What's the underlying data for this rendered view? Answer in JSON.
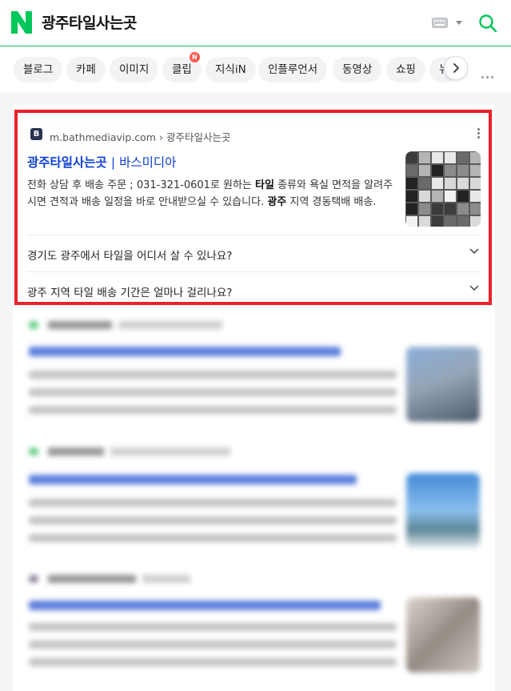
{
  "header": {
    "query": "광주타일사는곳",
    "logo_letter": "N",
    "brand_color": "#03c75a"
  },
  "tabs": [
    {
      "label": "블로그"
    },
    {
      "label": "카페"
    },
    {
      "label": "이미지"
    },
    {
      "label": "클립",
      "badge": "N"
    },
    {
      "label": "지식iN"
    },
    {
      "label": "인플루언서"
    },
    {
      "label": "동영상"
    },
    {
      "label": "쇼핑"
    },
    {
      "label": "뉴"
    }
  ],
  "highlight_color": "#e8212a",
  "first_result": {
    "favicon_letter": "B",
    "source_domain": "m.bathmediavip.com",
    "source_path": "광주타일사는곳",
    "title_main": "광주타일사는곳",
    "title_sep": "|",
    "title_brand": "바스미디아",
    "snippet_parts": [
      {
        "t": "전화 상담 후 배송 주문 ; 031-321-0601로 원하는 ",
        "b": false
      },
      {
        "t": "타일",
        "b": true
      },
      {
        "t": " 종류와 욕실 면적을 알려주시면 견적과 배송 일정을 바로 안내받으실 수 있습니다. ",
        "b": false
      },
      {
        "t": "광주",
        "b": true
      },
      {
        "t": " 지역 경동택배 배송.",
        "b": false
      }
    ],
    "faq": [
      {
        "q": "경기도 광주에서 타일을 어디서 살 수 있나요?"
      },
      {
        "q": "광주 지역 타일 배송 기간은 얼마나 걸리나요?"
      }
    ]
  }
}
